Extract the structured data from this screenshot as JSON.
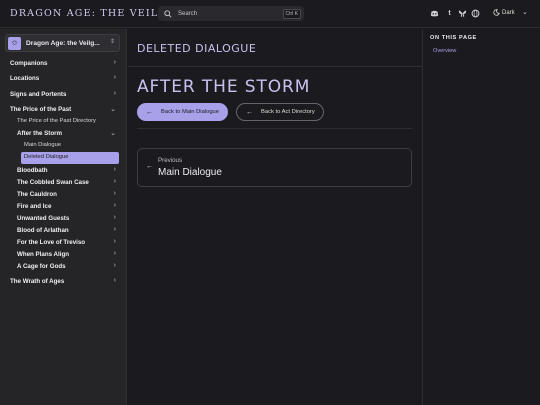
{
  "header": {
    "brand": "DRAGON AGE: THE VEILGUARD",
    "search_label": "Search",
    "search_shortcut": "Ctrl K",
    "social_icons": [
      "discord-icon",
      "tumblr-icon",
      "bluesky-icon",
      "globe-icon"
    ],
    "theme_label": "Dark"
  },
  "sidebar": {
    "title": "Dragon Age: the Veilg...",
    "items": [
      {
        "label": "Companions"
      },
      {
        "label": "Locations"
      },
      {
        "label": "Signs and Portents"
      },
      {
        "label": "The Price of the Past"
      },
      {
        "label": "The Price of the Past Directory"
      },
      {
        "label": "After the Storm"
      },
      {
        "label": "Main Dialogue"
      },
      {
        "label": "Deleted Dialogue"
      },
      {
        "label": "Bloodbath"
      },
      {
        "label": "The Cobbled Swan Case"
      },
      {
        "label": "The Cauldron"
      },
      {
        "label": "Fire and Ice"
      },
      {
        "label": "Unwanted Guests"
      },
      {
        "label": "Blood of Arlathan"
      },
      {
        "label": "For the Love of Treviso"
      },
      {
        "label": "When Plans Align"
      },
      {
        "label": "A Cage for Gods"
      },
      {
        "label": "The Wrath of Ages"
      }
    ]
  },
  "main": {
    "page_title": "DELETED DIALOGUE",
    "heading": "AFTER THE STORM",
    "buttons": {
      "back_main": "Back to Main Dialogue",
      "back_act": "Back to Act Directory"
    },
    "pager": {
      "label": "Previous",
      "title": "Main Dialogue"
    }
  },
  "aside": {
    "heading": "ON THIS PAGE",
    "links": [
      "Overview"
    ]
  },
  "colors": {
    "accent": "#a8a0e8",
    "background": "#1b1b1f",
    "sidebar": "#252528"
  }
}
